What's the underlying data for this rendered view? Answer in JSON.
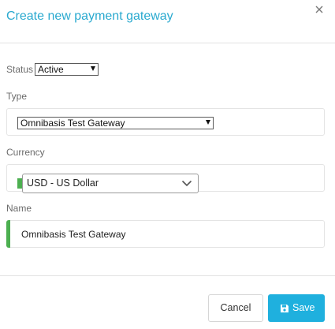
{
  "dialog": {
    "title": "Create new payment gateway",
    "close_icon": "close-icon"
  },
  "form": {
    "status": {
      "label": "Status",
      "value": "Active"
    },
    "type": {
      "label": "Type",
      "value": "Omnibasis Test Gateway"
    },
    "currency": {
      "label": "Currency",
      "value": "USD - US Dollar"
    },
    "name": {
      "label": "Name",
      "value": "Omnibasis Test Gateway"
    }
  },
  "footer": {
    "cancel_label": "Cancel",
    "save_label": "Save",
    "save_icon": "floppy-disk-icon"
  },
  "colors": {
    "title": "#29a9cf",
    "primary_button": "#1fb0de",
    "valid_indicator": "#4caf50"
  }
}
